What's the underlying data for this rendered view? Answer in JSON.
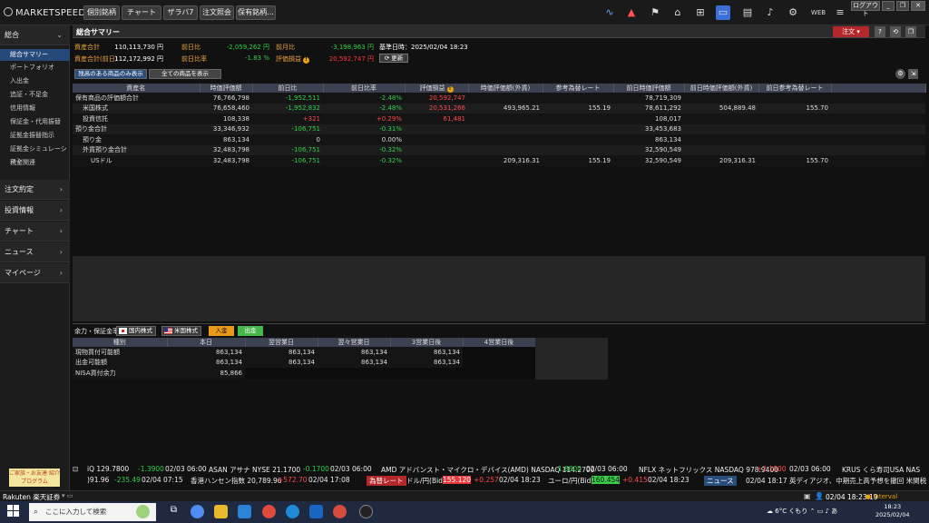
{
  "app": {
    "logo": "MARKETSPEED II"
  },
  "topbar": {
    "buttons": [
      "個別銘柄",
      "チャート",
      "ザラバ7",
      "注文照会",
      "保有銘柄..."
    ],
    "logout": "ログアウト",
    "win": [
      "_",
      "❐",
      "✕"
    ]
  },
  "sidebar": {
    "sections": [
      {
        "label": "総合",
        "chev": "⌄"
      },
      {
        "label": "注文約定",
        "chev": "›"
      },
      {
        "label": "投資情報",
        "chev": "›"
      },
      {
        "label": "チャート",
        "chev": "›"
      },
      {
        "label": "ニュース",
        "chev": "›"
      },
      {
        "label": "マイページ",
        "chev": "›"
      }
    ],
    "items": [
      "総合サマリー",
      "ポートフォリオ",
      "入出金",
      "追証・不足金",
      "信用情報",
      "保証金・代用振替",
      "証拠金振替指示",
      "証拠金シミュレーション",
      "税金関連"
    ],
    "promo": "ご家族・お友達 紹介プログラム"
  },
  "main": {
    "title": "総合サマリー",
    "order_btn": "注文",
    "small_btns": [
      "?",
      "⟲",
      "❐"
    ],
    "summary": {
      "asset_total_label": "資産合計",
      "asset_total_value": "110,113,730 円",
      "prev_diff_label": "前日比",
      "prev_diff_value": "-2,059,262 円",
      "prev_month_label": "前月比",
      "prev_month_value": "-3,198,963 円",
      "base_label": "基準日時：2025/02/04 18:23",
      "asset_prev_label": "資産合計(前日)",
      "asset_prev_value": "112,172,992 円",
      "prev_rate_label": "前日比率",
      "prev_rate_value": "-1.83 %",
      "pl_label": "評価損益",
      "pl_value": "20,592,747 円",
      "update_btn": "⟳ 更新"
    },
    "filters": {
      "held": "残高のある商品のみ表示",
      "all": "全ての商品を表示"
    },
    "table": {
      "headers": [
        "資産名",
        "時価評価額",
        "前日比",
        "前日比率",
        "評価損益",
        "時価評価額(外貨)",
        "参考為替レート",
        "前日時価評価額",
        "前日時価評価額(外貨)",
        "前日参考為替レート"
      ],
      "rows": [
        [
          "保有商品の評価額合計",
          "76,766,798",
          "-1,952,511",
          "-2.48%",
          "20,592,747",
          "",
          "",
          "78,719,309",
          "",
          ""
        ],
        [
          "米国株式",
          "76,658,460",
          "-1,952,832",
          "-2.48%",
          "20,531,266",
          "493,965.21",
          "155.19",
          "78,611,292",
          "504,889.48",
          "155.70"
        ],
        [
          "投資信託",
          "108,338",
          "+321",
          "+0.29%",
          "61,481",
          "",
          "",
          "108,017",
          "",
          ""
        ],
        [
          "預り金合計",
          "33,346,932",
          "-106,751",
          "-0.31%",
          "",
          "",
          "",
          "33,453,683",
          "",
          ""
        ],
        [
          "預り金",
          "863,134",
          "0",
          "0.00%",
          "",
          "",
          "",
          "863,134",
          "",
          ""
        ],
        [
          "外貨預り金合計",
          "32,483,798",
          "-106,751",
          "-0.32%",
          "",
          "",
          "",
          "32,590,549",
          "",
          ""
        ],
        [
          "USドル",
          "32,483,798",
          "-106,751",
          "-0.32%",
          "",
          "209,316.31",
          "155.19",
          "32,590,549",
          "209,316.31",
          "155.70"
        ]
      ]
    }
  },
  "bottom": {
    "label": "余力・保証金率",
    "flags": [
      "国内株式",
      "米国株式"
    ],
    "deposit": "入金",
    "withdraw": "出金",
    "headers": [
      "種別",
      "本日",
      "翌営業日",
      "翌々営業日",
      "3営業日後",
      "4営業日後"
    ],
    "rows": [
      [
        "現物買付可能額",
        "863,134",
        "863,134",
        "863,134",
        "863,134"
      ],
      [
        "出金可能額",
        "863,134",
        "863,134",
        "863,134",
        "863,134"
      ],
      [
        "NISA買付余力",
        "85,866",
        "",
        "",
        ""
      ]
    ]
  },
  "ticker1": [
    "iQ  129.7800",
    "-1.3900",
    "02/03  06:00",
    "ASAN  アサナ  NYSE  21.1700",
    "-0.1700",
    "02/03  06:00",
    "AMD  アドバンスト・マイクロ・デバイス(AMD)  NASDAQ  114.2700",
    "-1.6800",
    "02/03  06:00",
    "NFLX  ネットフリックス  NASDAQ  978.9400",
    "+2.1800",
    "02/03  06:00",
    "KRUS  くら寿司USA  NAS"
  ],
  "ticker2": [
    ")91.96",
    "-235.49",
    "02/04  07:15",
    "香港ハンセン指数  20,789.96",
    "+572.70",
    "02/04  17:08",
    "為替レート",
    "ドル/円(Bid)",
    "155.120",
    "+0.257",
    "02/04  18:23",
    "ユーロ/円(Bid)",
    "160.454",
    "+0.415",
    "02/04  18:23",
    "ニュース",
    "02/04  18:17  英ディアジオ、中期売上高予想を撤回  米関税"
  ],
  "statusbar": {
    "brand": "Rakuten 楽天証券",
    "time": "02/04 18:23:19",
    "interval": "● Interval"
  },
  "taskbar": {
    "search": "ここに入力して検索",
    "weather": "6°C  くもり",
    "time": "18:23",
    "date": "2025/02/04"
  },
  "colors": {
    "accent": "#26497a",
    "orange": "#e9a23b",
    "green": "#2fd14a",
    "red": "#ff4a4a",
    "order": "#b3262a"
  }
}
